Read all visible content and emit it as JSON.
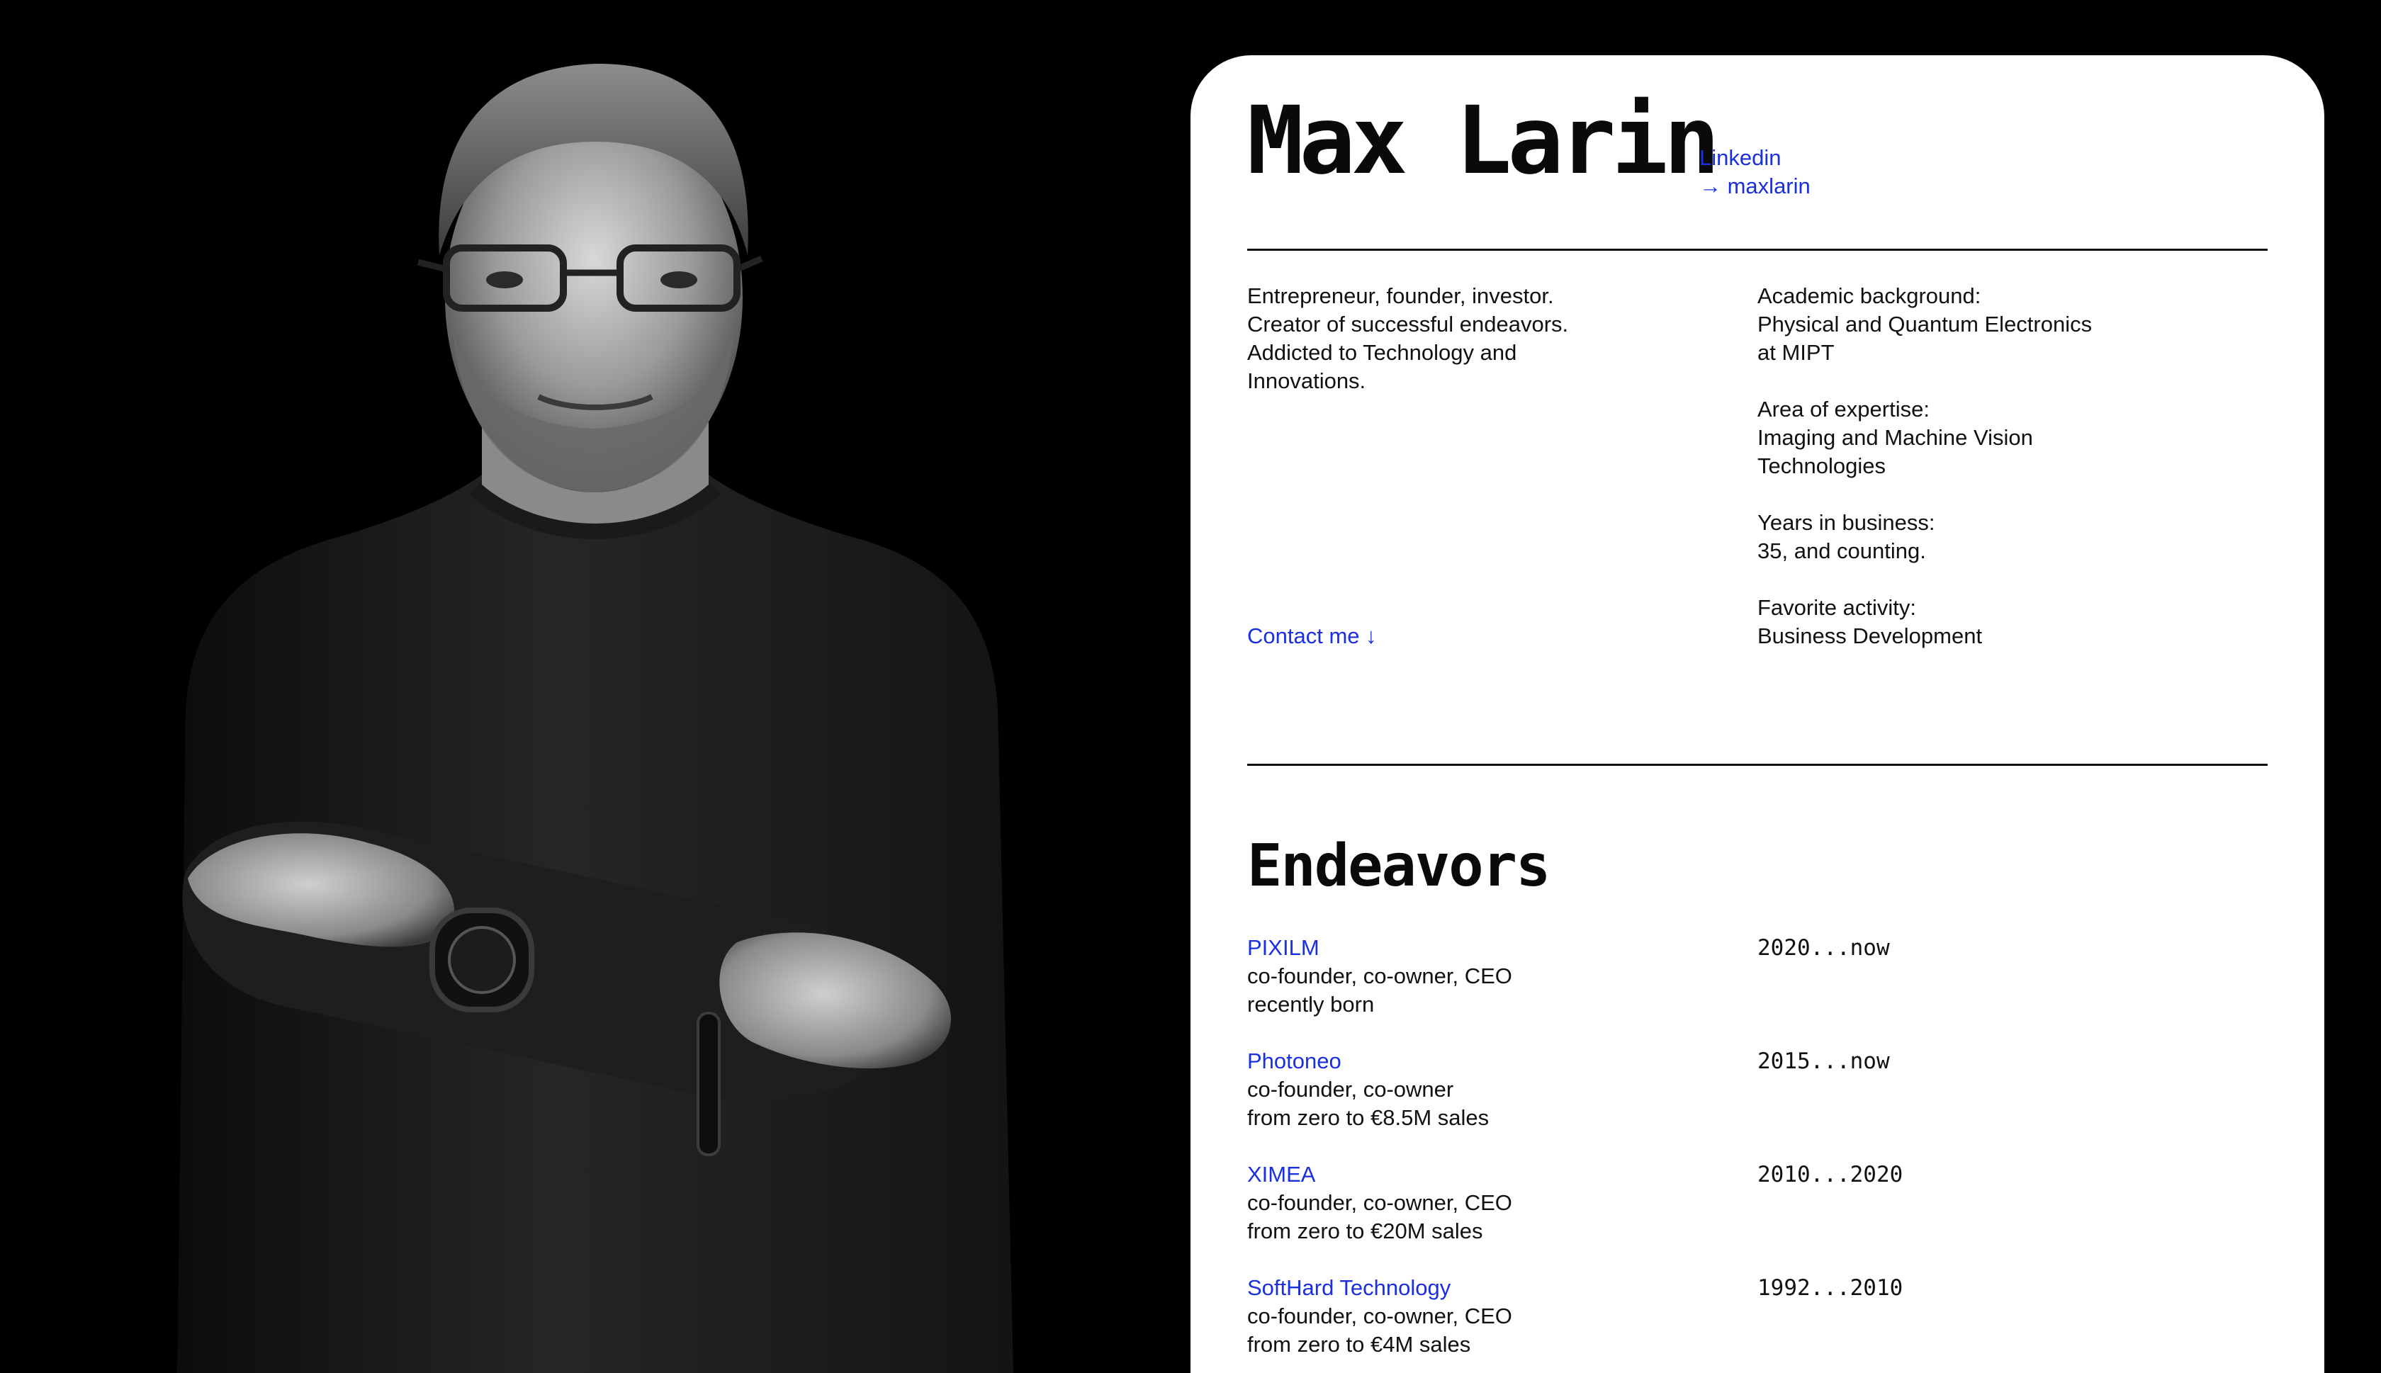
{
  "profile": {
    "name": "Max Larin",
    "social": {
      "label": "Linkedin",
      "handle": "→ maxlarin"
    }
  },
  "bio": {
    "lines": [
      "Entrepreneur, founder, investor.",
      "Creator of successful endeavors.",
      "Addicted to Technology and",
      "Innovations."
    ],
    "contact_label": "Contact me ↓"
  },
  "facts": [
    {
      "label": "Academic background:",
      "values": [
        "Physical and Quantum Electronics",
        "at MIPT"
      ]
    },
    {
      "label": "Area of expertise:",
      "values": [
        "Imaging and Machine Vision",
        "Technologies"
      ]
    },
    {
      "label": "Years in business:",
      "values": [
        "35, and counting."
      ]
    },
    {
      "label": "Favorite activity:",
      "values": [
        "Business Development"
      ]
    }
  ],
  "endeavors": {
    "title": "Endeavors",
    "items": [
      {
        "company": "PIXILM",
        "role": "co-founder, co-owner, CEO",
        "note": "recently born",
        "years": "2020...now"
      },
      {
        "company": "Photoneo",
        "role": "co-founder, co-owner",
        "note": "from zero to €8.5M sales",
        "years": "2015...now"
      },
      {
        "company": "XIMEA",
        "role": "co-founder, co-owner, CEO",
        "note": "from zero to €20M sales",
        "years": "2010...2020"
      },
      {
        "company": "SoftHard Technology",
        "role": "co-founder, co-owner, CEO",
        "note": "from zero to €4M sales",
        "years": "1992...2010"
      }
    ]
  },
  "colors": {
    "page_background": "#000000",
    "card_background": "#ffffff",
    "link": "#1a2fe0",
    "text": "#111111"
  }
}
